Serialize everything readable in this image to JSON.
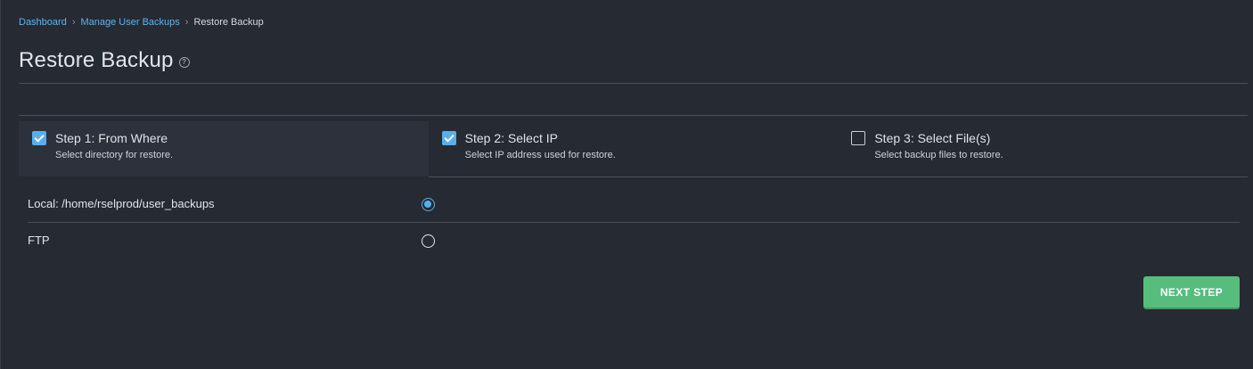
{
  "breadcrumb": {
    "items": [
      "Dashboard",
      "Manage User Backups"
    ],
    "current": "Restore Backup",
    "separator": ">"
  },
  "page": {
    "title": "Restore Backup",
    "help_icon": "?"
  },
  "steps": [
    {
      "title": "Step 1: From Where",
      "desc": "Select directory for restore.",
      "checked": true
    },
    {
      "title": "Step 2: Select IP",
      "desc": "Select IP address used for restore.",
      "checked": true
    },
    {
      "title": "Step 3: Select File(s)",
      "desc": "Select backup files to restore.",
      "checked": false
    }
  ],
  "options": [
    {
      "label": "Local: /home/rselprod/user_backups",
      "selected": true
    },
    {
      "label": "FTP",
      "selected": false
    }
  ],
  "actions": {
    "next_label": "NEXT STEP"
  },
  "colors": {
    "background": "#262a33",
    "link": "#5fb4f0",
    "accent": "#5aaee8",
    "success": "#56bd7d"
  }
}
